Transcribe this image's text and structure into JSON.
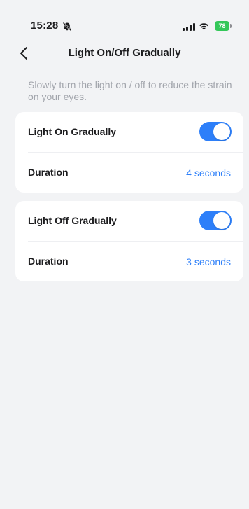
{
  "status_bar": {
    "time": "15:28",
    "battery": "78",
    "icons": [
      "bell-muted-icon",
      "signal-icon",
      "wifi-icon",
      "battery-icon"
    ]
  },
  "nav": {
    "back_icon": "chevron-left-icon",
    "title": "Light On/Off Gradually"
  },
  "description": "Slowly turn the light on / off to reduce the strain on your eyes.",
  "colors": {
    "accent": "#2d7ff9",
    "background": "#f2f3f5",
    "card": "#ffffff",
    "secondary_text": "#a1a4ab",
    "battery": "#34c759"
  },
  "settings": [
    {
      "label": "Light On Gradually",
      "enabled": true,
      "duration_label": "Duration",
      "duration_value": "4 seconds"
    },
    {
      "label": "Light Off Gradually",
      "enabled": true,
      "duration_label": "Duration",
      "duration_value": "3 seconds"
    }
  ]
}
